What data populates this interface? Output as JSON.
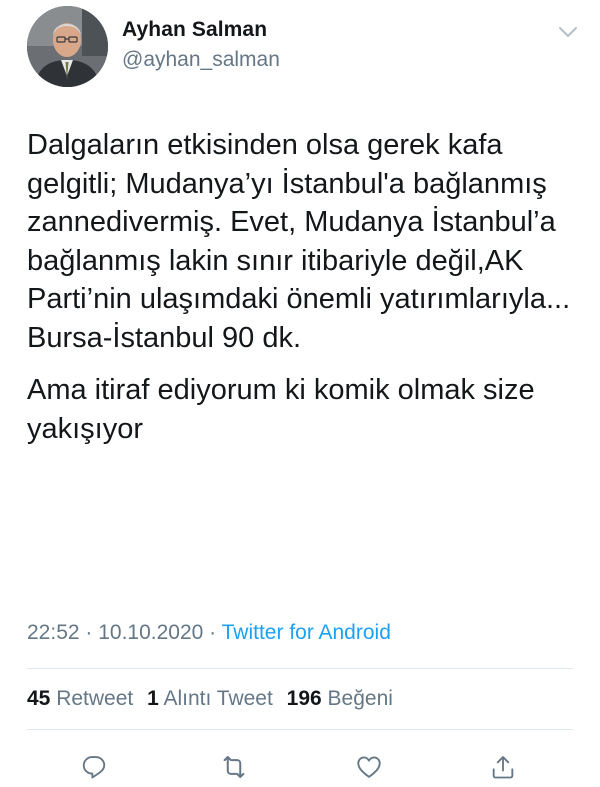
{
  "author": {
    "name": "Ayhan Salman",
    "handle": "@ayhan_salman",
    "avatar_icon": "profile-photo"
  },
  "tweet": {
    "paragraphs": [
      "Dalgaların etkisinden olsa gerek kafa gelgitli; Mudanya’yı İstanbul'a bağlanmış zannedivermiş. Evet, Mudanya İstanbul’a bağlanmış lakin sınır itibariyle değil,AK Parti’nin ulaşımdaki önemli yatırımlarıyla... Bursa-İstanbul 90 dk.",
      "Ama itiraf ediyorum ki komik olmak size yakışıyor"
    ]
  },
  "meta": {
    "time": "22:52",
    "separator1": " · ",
    "date": "10.10.2020",
    "separator2": " · ",
    "source": "Twitter for Android"
  },
  "stats": {
    "retweets": {
      "count": "45",
      "label": "Retweet"
    },
    "quotes": {
      "count": "1",
      "label": "Alıntı Tweet"
    },
    "likes": {
      "count": "196",
      "label": "Beğeni"
    }
  },
  "actions": {
    "reply_icon": "reply-icon",
    "retweet_icon": "retweet-icon",
    "like_icon": "heart-icon",
    "share_icon": "share-icon"
  },
  "colors": {
    "text": "#14171a",
    "secondary": "#657786",
    "link": "#1da1f2",
    "divider": "#e1e8ed"
  }
}
